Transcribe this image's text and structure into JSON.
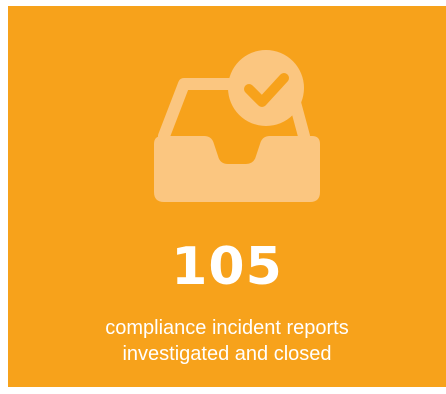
{
  "stat": {
    "value": "105",
    "caption_line1": "compliance incident reports",
    "caption_line2": "investigated and closed"
  },
  "icon": {
    "name": "inbox-checkmark-icon"
  },
  "colors": {
    "background": "#F7A21B",
    "icon_fill": "#FBC680",
    "icon_accent": "#F7A21B",
    "text": "#FFFFFF"
  }
}
